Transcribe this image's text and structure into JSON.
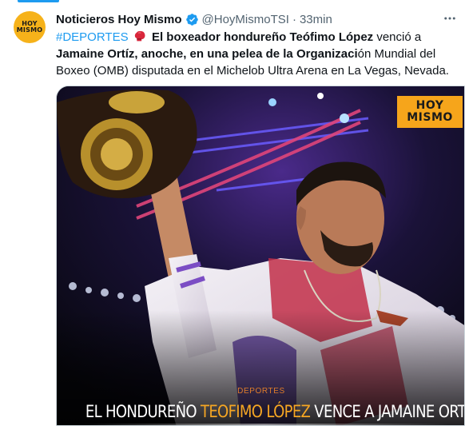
{
  "tweet": {
    "avatar_line1": "HOY",
    "avatar_line2": "MISMO",
    "display_name": "Noticieros Hoy Mismo",
    "handle": "@HoyMismoTSI",
    "separator": "·",
    "time": "33min",
    "body": {
      "hashtag": "#DEPORTES",
      "line1_bold": "El boxeador hondureño Teófimo López",
      "line1_rest": " venció a",
      "line2_bold": "Jamaine Ortíz, anoche, en una pelea de la Organizaci",
      "line2_rest": "ón Mundial del",
      "line3": "Boxeo (OMB) disputada en el Michelob Ultra Arena en La Vegas, Nevada."
    },
    "icons": {
      "verified": "verified-badge-icon",
      "more": "more-options-icon",
      "emoji": "boxing-glove-icon"
    }
  },
  "media": {
    "logo_line1": "HOY",
    "logo_line2": "MISMO",
    "category": "DEPORTES",
    "headline_pre": "EL HONDUREÑO ",
    "headline_highlight": "TEOFIMO LÓPEZ",
    "headline_post": " VENCE A JAMAINE ORTÍZ"
  },
  "colors": {
    "link": "#1d9bf0",
    "muted": "#536471",
    "brand_orange": "#f6a51b"
  }
}
